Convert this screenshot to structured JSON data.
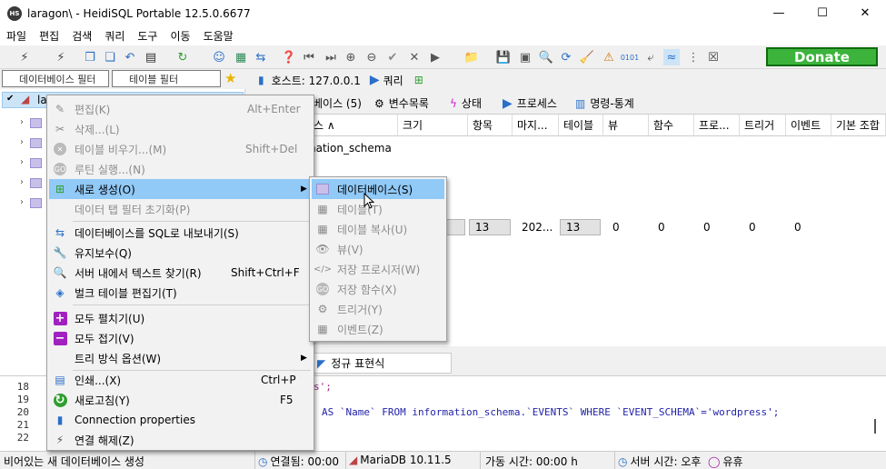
{
  "window": {
    "title": "laragon\\ - HeidiSQL Portable 12.5.0.6677",
    "app_icon_text": "HS",
    "controls": {
      "minimize": "—",
      "maximize": "☐",
      "close": "✕"
    }
  },
  "menubar": [
    "파일",
    "편집",
    "검색",
    "쿼리",
    "도구",
    "이동",
    "도움말"
  ],
  "toolbar": {
    "donate_label": "Donate"
  },
  "filters": {
    "db_filter": "데이터베이스 필터",
    "table_filter": "테이블 필터"
  },
  "tree": {
    "root_label": "la"
  },
  "host": {
    "label": "호스트: 127.0.0.1",
    "query_label": "쿼리"
  },
  "tabs": [
    {
      "label": "베이스 (5)"
    },
    {
      "label": "변수목록"
    },
    {
      "label": "상태"
    },
    {
      "label": "프로세스"
    },
    {
      "label": "명령-통계"
    }
  ],
  "grid": {
    "columns": [
      "스 ∧",
      "크기",
      "항목",
      "마지...",
      "테이블",
      "뷰",
      "함수",
      "프로...",
      "트리거",
      "이벤트",
      "기본 조합"
    ],
    "row1": {
      "name": "nation_schema"
    },
    "row2": {
      "items": "13",
      "modified": "202...",
      "tables": "13",
      "views": "0",
      "functions": "0",
      "procs": "0",
      "triggers": "0",
      "events": "0"
    }
  },
  "regex_tab": {
    "label": "정규 표현식"
  },
  "editor": {
    "lines": [
      {
        "num": "18",
        "code": "s';"
      },
      {
        "num": "19",
        "code": ""
      },
      {
        "num": "20",
        "code": "AS `Name` FROM information_schema.`EVENTS` WHERE `EVENT_SCHEMA`='wordpress';"
      },
      {
        "num": "21",
        "code": ""
      },
      {
        "num": "22",
        "code": ""
      }
    ]
  },
  "statusbar": {
    "message": "비어있는 새 데이터베이스 생성",
    "connected": "연결됨: 00:00",
    "server": "MariaDB 10.11.5",
    "uptime": "가동 시간: 00:00 h",
    "server_time": "서버 시간: 오후",
    "idle": "유휴"
  },
  "context_menu": {
    "items": [
      {
        "label": "편집(K)",
        "shortcut": "Alt+Enter"
      },
      {
        "label": "삭제...(L)",
        "shortcut": ""
      },
      {
        "label": "테이블 비우기...(M)",
        "shortcut": "Shift+Del"
      },
      {
        "label": "루틴 실행...(N)",
        "shortcut": ""
      },
      {
        "label": "새로 생성(O)",
        "shortcut": ""
      },
      {
        "label": "데이터 탭 필터 초기화(P)",
        "shortcut": ""
      },
      {
        "label": "데이터베이스를 SQL로 내보내기(S)",
        "shortcut": ""
      },
      {
        "label": "유지보수(Q)",
        "shortcut": ""
      },
      {
        "label": "서버 내에서 텍스트 찾기(R)",
        "shortcut": "Shift+Ctrl+F"
      },
      {
        "label": "벌크 테이블 편집기(T)",
        "shortcut": ""
      },
      {
        "label": "모두 펼치기(U)",
        "shortcut": ""
      },
      {
        "label": "모두 접기(V)",
        "shortcut": ""
      },
      {
        "label": "트리 방식 옵션(W)",
        "shortcut": ""
      },
      {
        "label": "인쇄...(X)",
        "shortcut": "Ctrl+P"
      },
      {
        "label": "새로고침(Y)",
        "shortcut": "F5"
      },
      {
        "label": "Connection properties",
        "shortcut": ""
      },
      {
        "label": "연결 해제(Z)",
        "shortcut": ""
      }
    ]
  },
  "submenu": {
    "items": [
      {
        "label": "데이터베이스(S)"
      },
      {
        "label": "테이블(T)"
      },
      {
        "label": "테이블 복사(U)"
      },
      {
        "label": "뷰(V)"
      },
      {
        "label": "저장 프로시저(W)"
      },
      {
        "label": "저장 함수(X)"
      },
      {
        "label": "트리거(Y)"
      },
      {
        "label": "이벤트(Z)"
      }
    ]
  }
}
